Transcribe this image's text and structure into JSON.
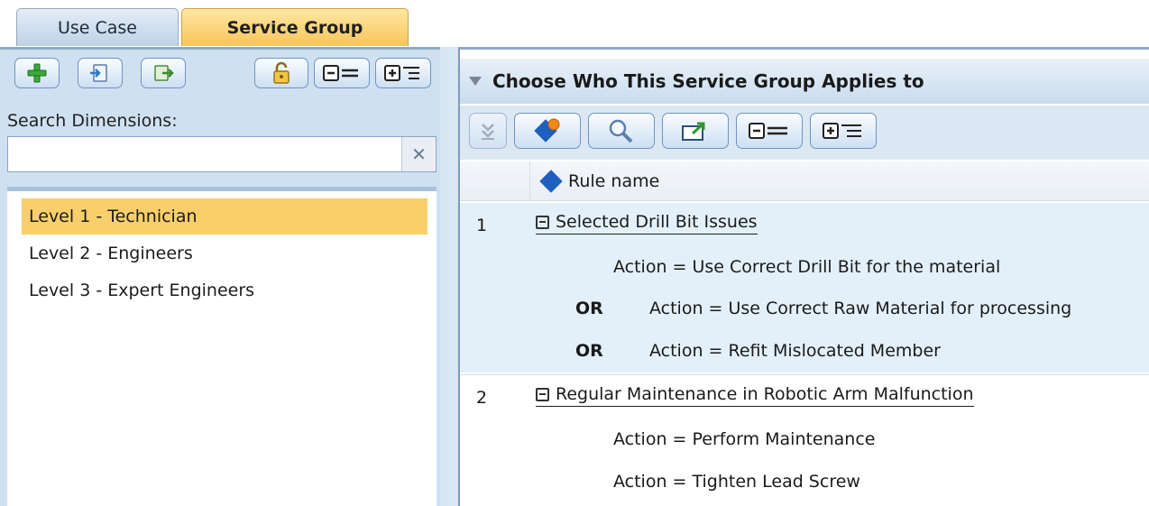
{
  "tabs": [
    {
      "label": "Use Case"
    },
    {
      "label": "Service Group"
    }
  ],
  "left_panel": {
    "toolbar_icons": [
      "add-icon",
      "import-icon",
      "export-icon",
      "unlock-icon",
      "collapse-all-icon",
      "expand-all-icon"
    ],
    "search_label": "Search Dimensions:",
    "search_value": "",
    "search_placeholder": "",
    "clear_glyph": "✕",
    "dimensions": [
      {
        "label": "Level 1 - Technician"
      },
      {
        "label": "Level 2 - Engineers"
      },
      {
        "label": "Level 3 - Expert Engineers"
      }
    ]
  },
  "right_panel": {
    "title": "Choose Who This Service Group Applies to",
    "toolbar_icons": [
      "move-down-icon",
      "tag-icon",
      "search-icon",
      "export-rule-icon",
      "collapse-all-icon",
      "expand-all-icon"
    ],
    "column_header": "Rule name",
    "rules": [
      {
        "number": "1",
        "title": "Selected Drill Bit Issues",
        "conditions": [
          {
            "op": "",
            "text": "Action = Use Correct Drill Bit for the material"
          },
          {
            "op": "OR",
            "text": "Action = Use Correct Raw Material for processing"
          },
          {
            "op": "OR",
            "text": "Action = Refit Mislocated Member"
          }
        ]
      },
      {
        "number": "2",
        "title": "Regular Maintenance in Robotic Arm Malfunction",
        "conditions": [
          {
            "op": "",
            "text": "Action = Perform Maintenance"
          },
          {
            "op": "",
            "text": "Action = Tighten Lead Screw"
          }
        ]
      }
    ]
  },
  "colors": {
    "active_tab": "#f7c55a",
    "selected_row": "#f8cf6a",
    "panel_blue": "#cfe0f1",
    "rule_shade": "#e3f0fa",
    "accent_blue": "#1f5fbf"
  }
}
